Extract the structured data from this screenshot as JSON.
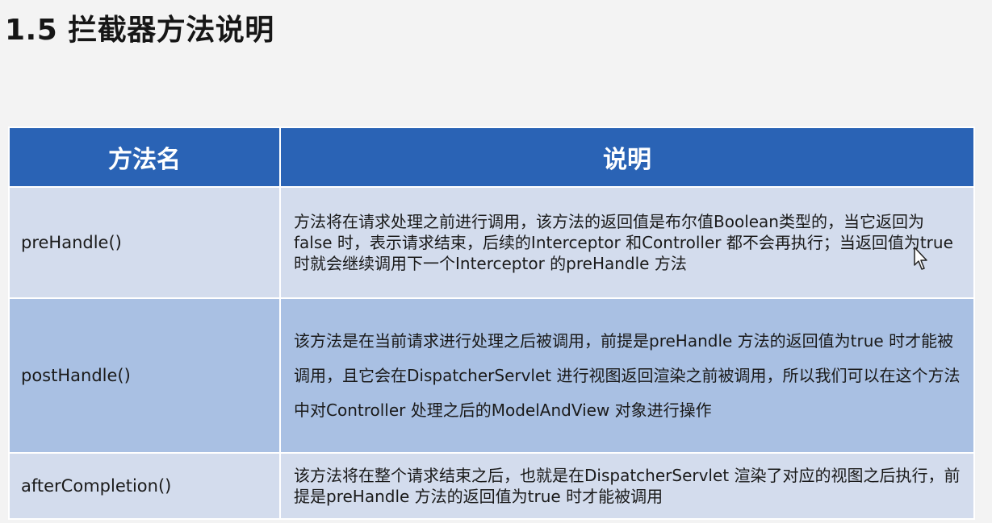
{
  "slide": {
    "title": "1.5 拦截器方法说明"
  },
  "table": {
    "headers": [
      "方法名",
      "说明"
    ],
    "rows": [
      {
        "method": "preHandle()",
        "description": "方法将在请求处理之前进行调用，该方法的返回值是布尔值Boolean类型的，当它返回为false 时，表示请求结束，后续的Interceptor 和Controller 都不会再执行；当返回值为true 时就会继续调用下一个Interceptor 的preHandle 方法"
      },
      {
        "method": "postHandle()",
        "description": "该方法是在当前请求进行处理之后被调用，前提是preHandle 方法的返回值为true 时才能被调用，且它会在DispatcherServlet 进行视图返回渲染之前被调用，所以我们可以在这个方法中对Controller 处理之后的ModelAndView 对象进行操作"
      },
      {
        "method": "afterCompletion()",
        "description": "该方法将在整个请求结束之后，也就是在DispatcherServlet 渲染了对应的视图之后执行，前提是preHandle 方法的返回值为true 时才能被调用"
      }
    ]
  },
  "colors": {
    "header_bg": "#2a63b5",
    "row_light": "#d3dced",
    "row_dark": "#a9c0e3",
    "background": "#f3f3f3"
  },
  "icons": {
    "cursor": "mouse-pointer-icon"
  }
}
